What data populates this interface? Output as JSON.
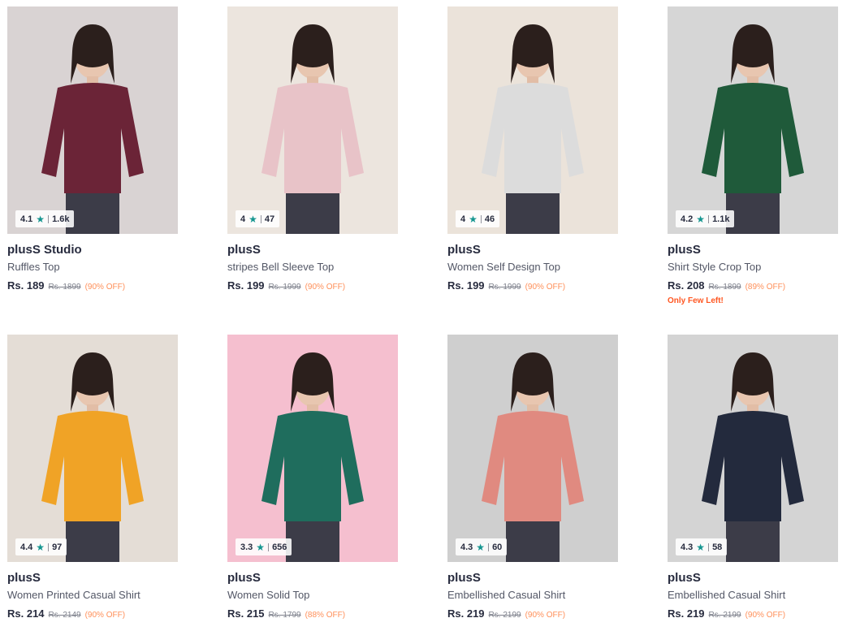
{
  "products": [
    {
      "brand": "plusS Studio",
      "name": "Ruffles Top",
      "price": "Rs. 189",
      "mrp": "Rs. 1899",
      "discount": "(90% OFF)",
      "rating": "4.1",
      "count": "1.6k",
      "star_icon": "star-icon",
      "bg": "#d9d3d3",
      "garment": "#6b2437",
      "extra": ""
    },
    {
      "brand": "plusS",
      "name": "stripes Bell Sleeve Top",
      "price": "Rs. 199",
      "mrp": "Rs. 1999",
      "discount": "(90% OFF)",
      "rating": "4",
      "count": "47",
      "star_icon": "star-icon",
      "bg": "#ece5de",
      "garment": "#e8c3c8",
      "extra": ""
    },
    {
      "brand": "plusS",
      "name": "Women Self Design Top",
      "price": "Rs. 199",
      "mrp": "Rs. 1999",
      "discount": "(90% OFF)",
      "rating": "4",
      "count": "46",
      "star_icon": "star-icon",
      "bg": "#ebe3da",
      "garment": "#dcdcdc",
      "extra": ""
    },
    {
      "brand": "plusS",
      "name": "Shirt Style Crop Top",
      "price": "Rs. 208",
      "mrp": "Rs. 1899",
      "discount": "(89% OFF)",
      "rating": "4.2",
      "count": "1.1k",
      "star_icon": "star-icon",
      "bg": "#d6d6d6",
      "garment": "#1f5a3a",
      "extra": "Only Few Left!"
    },
    {
      "brand": "plusS",
      "name": "Women Printed Casual Shirt",
      "price": "Rs. 214",
      "mrp": "Rs. 2149",
      "discount": "(90% OFF)",
      "rating": "4.4",
      "count": "97",
      "star_icon": "star-icon",
      "bg": "#e4ddd6",
      "garment": "#f0a326",
      "extra": ""
    },
    {
      "brand": "plusS",
      "name": "Women Solid Top",
      "price": "Rs. 215",
      "mrp": "Rs. 1799",
      "discount": "(88% OFF)",
      "rating": "3.3",
      "count": "656",
      "star_icon": "star-icon",
      "bg": "#f5bfcf",
      "garment": "#1f6d5d",
      "extra": ""
    },
    {
      "brand": "plusS",
      "name": "Embellished Casual Shirt",
      "price": "Rs. 219",
      "mrp": "Rs. 2199",
      "discount": "(90% OFF)",
      "rating": "4.3",
      "count": "60",
      "star_icon": "star-icon",
      "bg": "#cfcfcf",
      "garment": "#e08a80",
      "extra": ""
    },
    {
      "brand": "plusS",
      "name": "Embellished Casual Shirt",
      "price": "Rs. 219",
      "mrp": "Rs. 2199",
      "discount": "(90% OFF)",
      "rating": "4.3",
      "count": "58",
      "star_icon": "star-icon",
      "bg": "#d4d4d4",
      "garment": "#232a3d",
      "extra": ""
    }
  ],
  "colors": {
    "rating_star": "#14958f",
    "discount": "#ff905a",
    "few_left": "#ff5722"
  }
}
